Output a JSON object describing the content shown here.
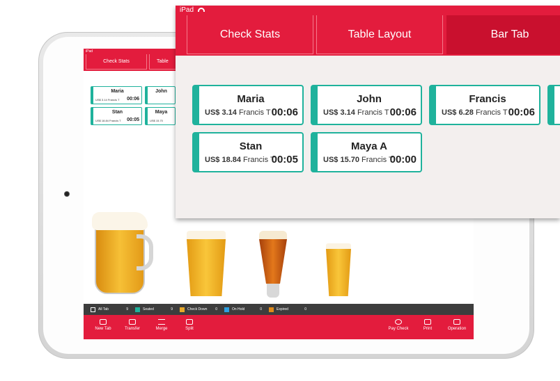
{
  "device": {
    "status_label": "iPad"
  },
  "tabs": [
    {
      "label": "Check Stats"
    },
    {
      "label": "Table Layout"
    },
    {
      "label": "Bar Tab"
    }
  ],
  "tabs_small": [
    {
      "label": "Check Stats"
    },
    {
      "label": "Table Layout"
    }
  ],
  "tabs_small_short": "Table",
  "small_cards": [
    {
      "name": "Maria",
      "amount": "US$ 3.14",
      "server": "Francis T",
      "time": "00:06"
    },
    {
      "name": "John",
      "amount": "",
      "server": "",
      "time": ""
    },
    {
      "name": "Stan",
      "amount": "US$ 18.84",
      "server": "Francis T",
      "time": "00:05"
    },
    {
      "name": "Maya",
      "amount": "US$ 15.70",
      "server": "",
      "time": ""
    }
  ],
  "tabs_cards": [
    {
      "name": "Maria",
      "amount": "US$ 3.14",
      "server": "Francis T",
      "time": "00:06"
    },
    {
      "name": "John",
      "amount": "US$ 3.14",
      "server": "Francis T",
      "time": "00:06"
    },
    {
      "name": "Francis",
      "amount": "US$ 6.28",
      "server": "Francis T",
      "time": "00:06"
    },
    {
      "name": "Stan",
      "amount": "US$ 18.84",
      "server": "Francis T",
      "time": "00:05"
    },
    {
      "name": "Maya A",
      "amount": "US$ 15.70",
      "server": "Francis T",
      "time": "00:00"
    }
  ],
  "legend": [
    {
      "label": "All Tab",
      "count": "9",
      "color": "#ffffff"
    },
    {
      "label": "Seated",
      "count": "9",
      "color": "#1fb29c"
    },
    {
      "label": "Check Down",
      "count": "0",
      "color": "#e8a92a"
    },
    {
      "label": "On Hold",
      "count": "0",
      "color": "#2d9fe0"
    },
    {
      "label": "Expired",
      "count": "0",
      "color": "#e08a1a"
    }
  ],
  "toolbar": {
    "new_tab": "New Tab",
    "transfer": "Transfer",
    "merge": "Merge",
    "split": "Split",
    "pay_check": "Pay Check",
    "print": "Print",
    "operation": "Operation"
  },
  "colors": {
    "accent": "#e31c3d",
    "seated": "#1fb29c",
    "active_tab": "#c9102e"
  }
}
